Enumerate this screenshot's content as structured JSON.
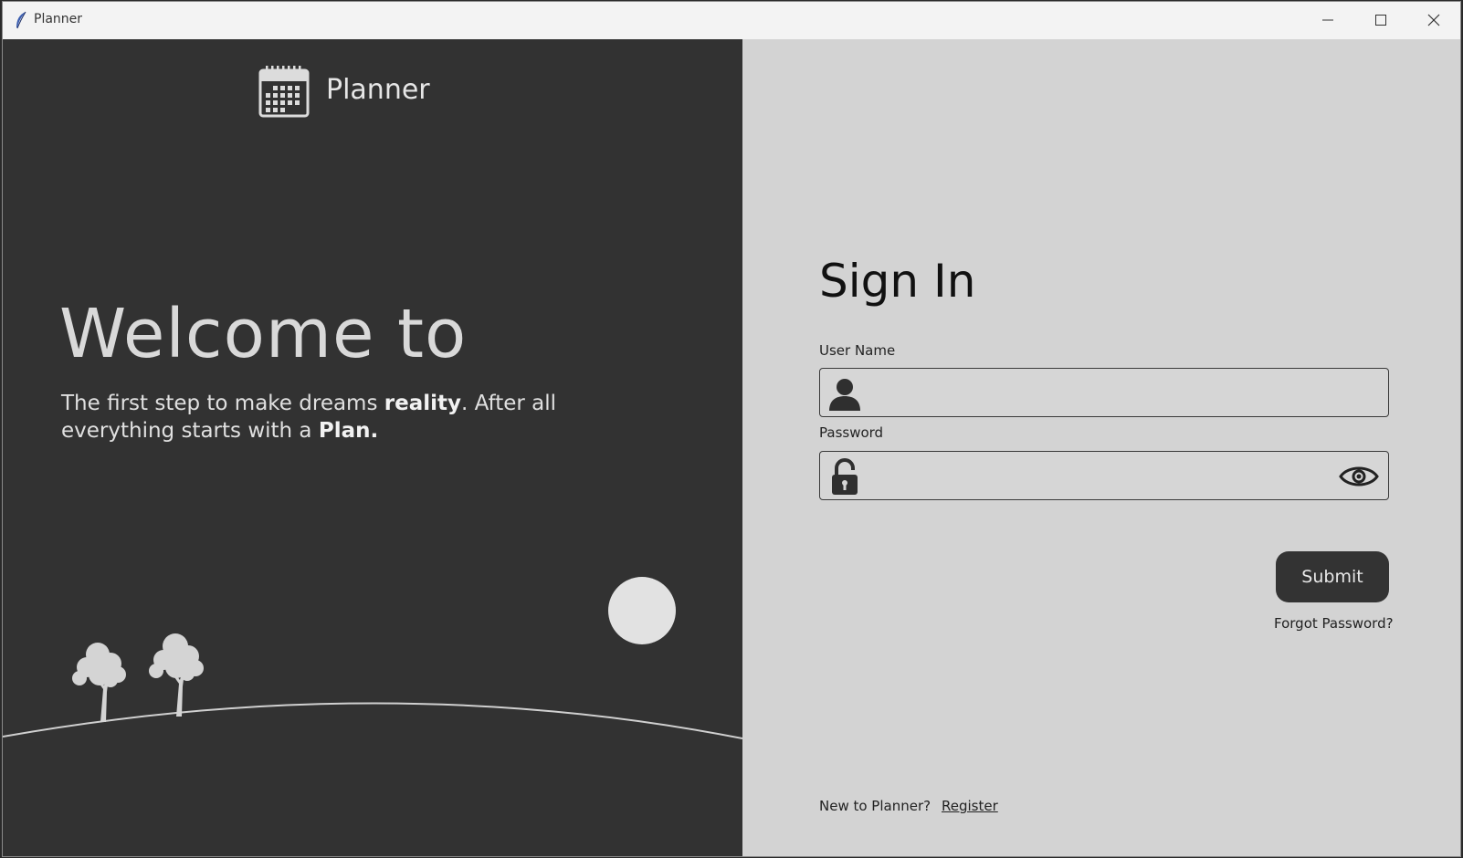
{
  "window": {
    "title": "Planner",
    "app_icon": "feather-icon",
    "controls": [
      "minimize-icon",
      "maximize-icon",
      "close-icon"
    ]
  },
  "left": {
    "brand_icon": "calendar-icon",
    "brand_name": "Planner",
    "welcome": "Welcome to",
    "tagline": {
      "part1": "The first step to make dreams ",
      "bold1": "reality",
      "part2": ". After all everything starts with a ",
      "bold2": "Plan."
    }
  },
  "signin": {
    "title": "Sign In",
    "username": {
      "label": "User Name",
      "value": "",
      "icon": "user-icon"
    },
    "password": {
      "label": "Password",
      "value": "",
      "icon": "unlock-icon",
      "toggle_icon": "eye-icon"
    },
    "submit_label": "Submit",
    "forgot_label": "Forgot Password?",
    "new_text": "New to Planner?",
    "register_label": "Register"
  },
  "colors": {
    "left_panel": "#323232",
    "right_panel": "#d3d3d3",
    "button": "#333333"
  }
}
